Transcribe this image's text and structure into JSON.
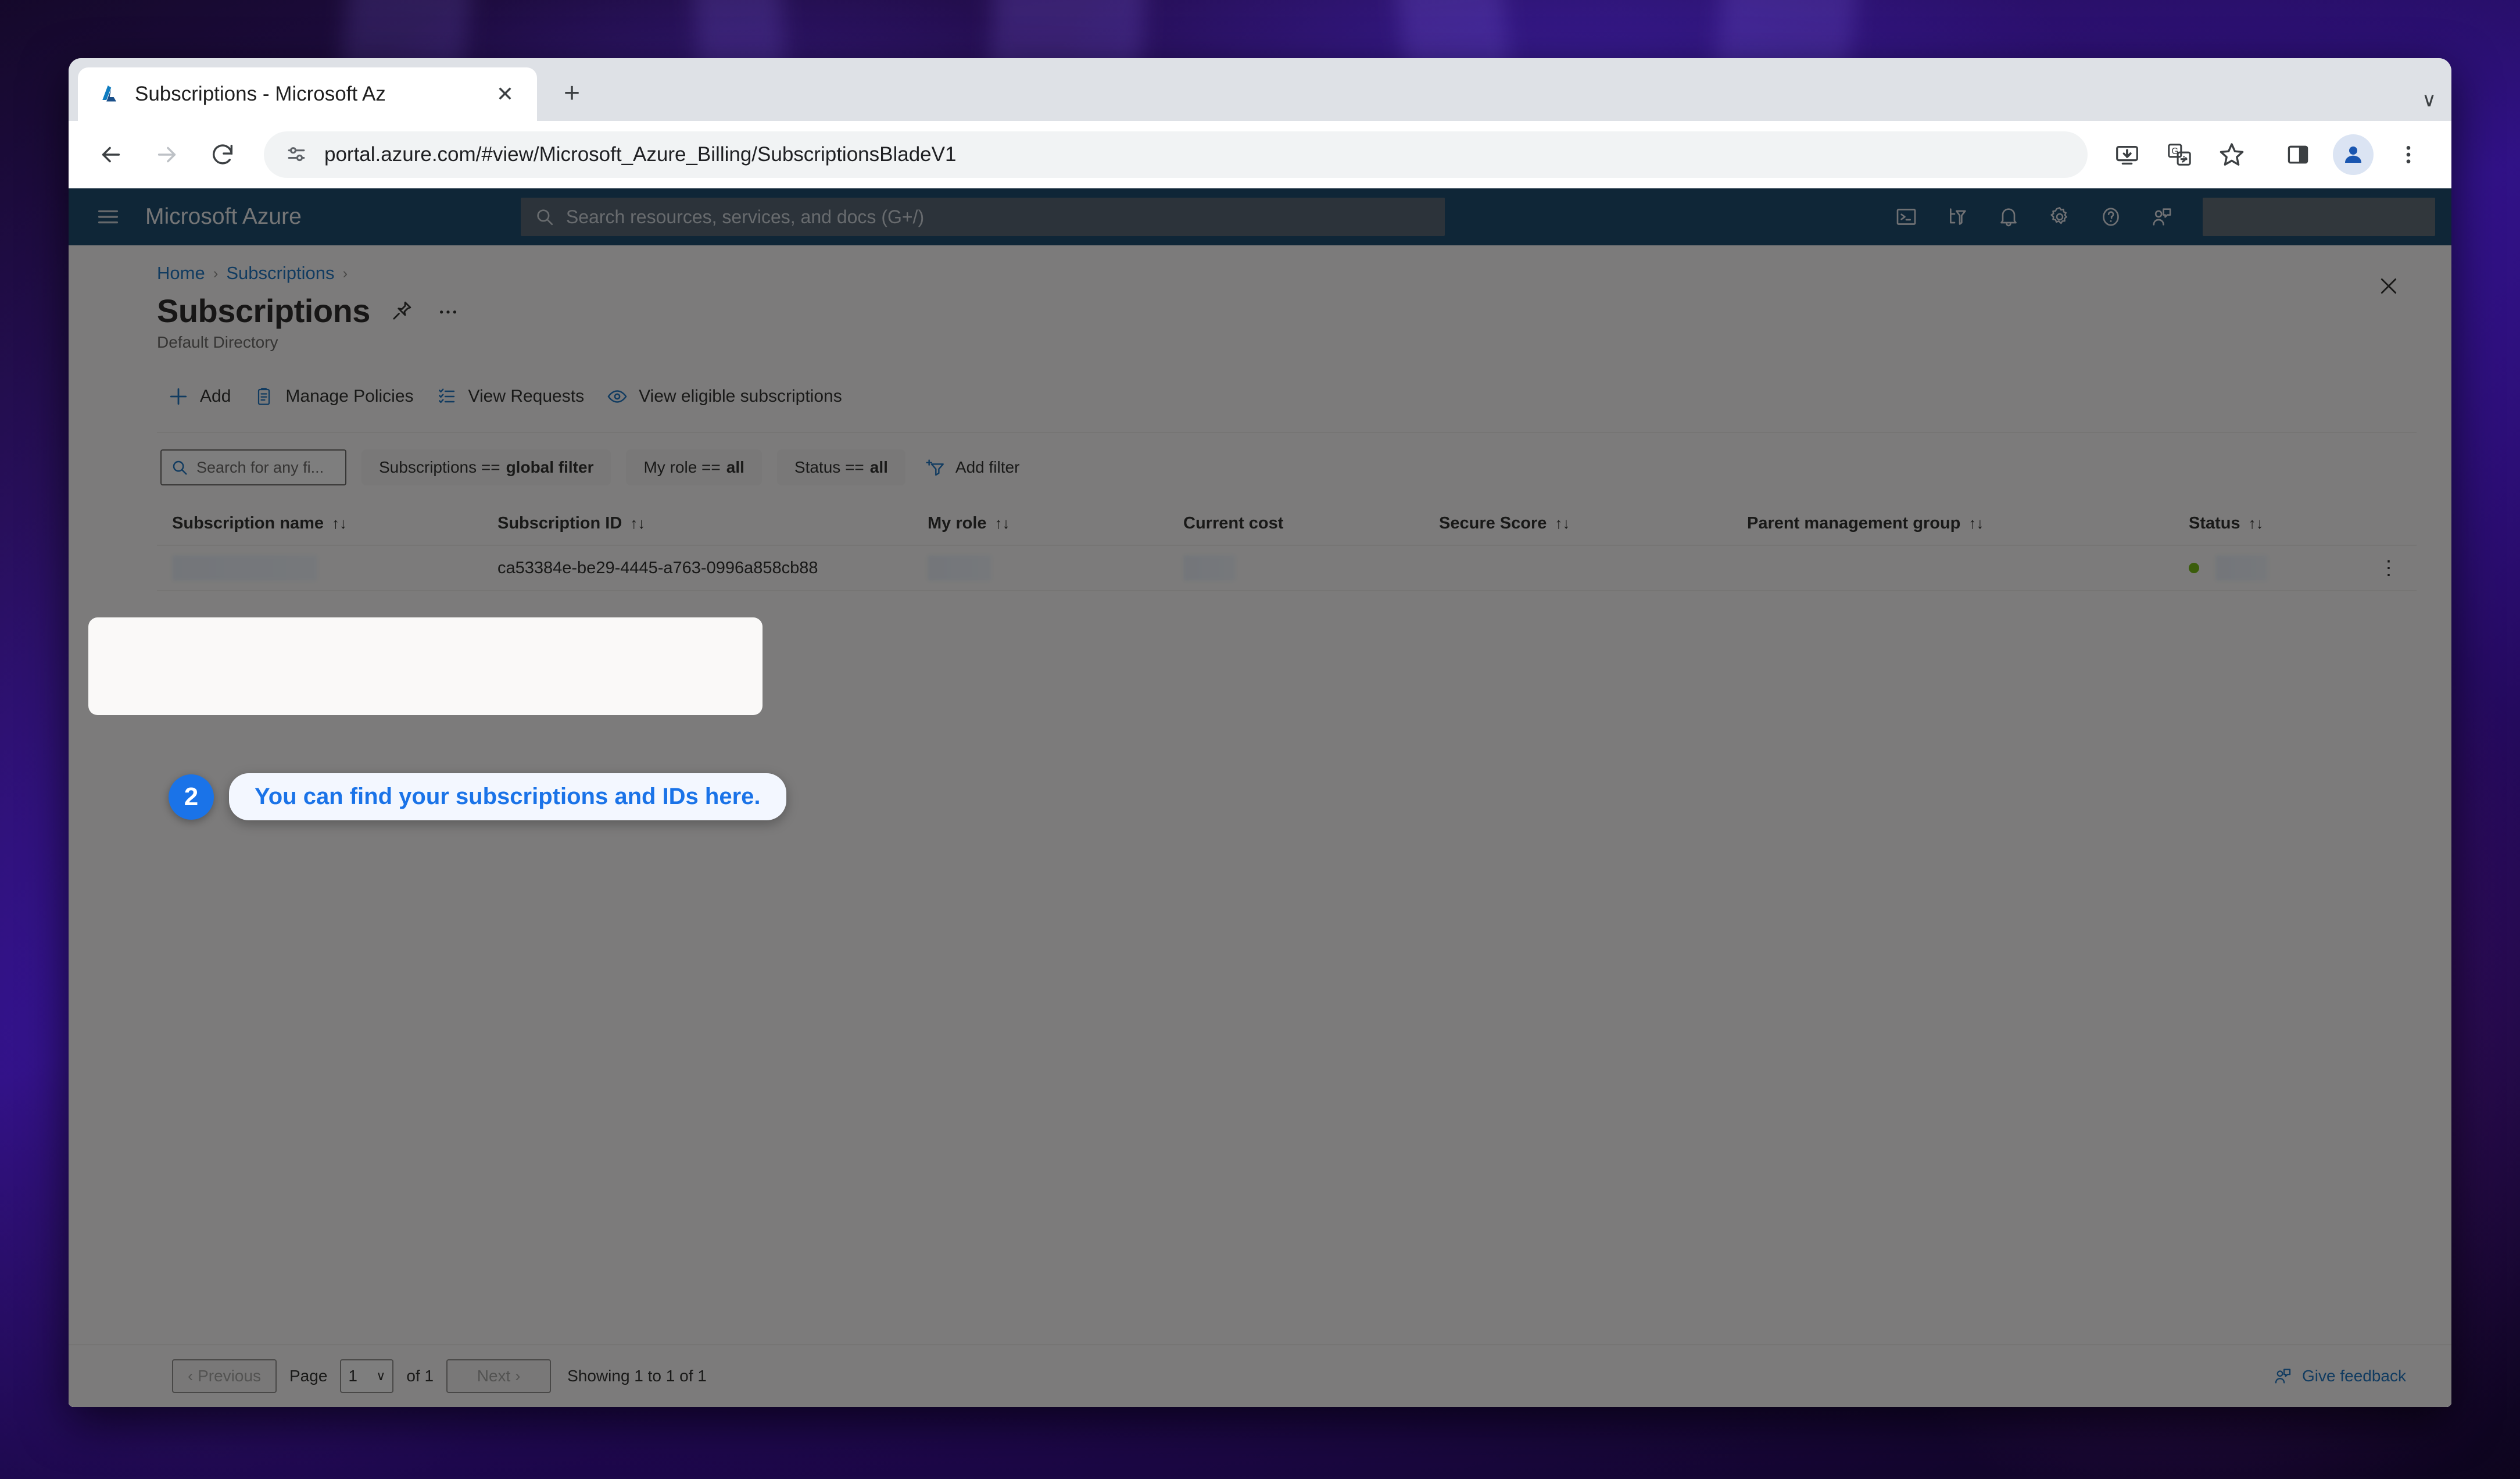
{
  "browser": {
    "tab": {
      "title": "Subscriptions - Microsoft Az",
      "favicon_name": "azure-favicon",
      "close_label": "✕"
    },
    "newtab_label": "+",
    "tabstrip_chevron": "∨",
    "nav": {
      "back": "←",
      "forward": "→",
      "reload": "⟳"
    },
    "omnibox": {
      "url": "portal.azure.com/#view/Microsoft_Azure_Billing/SubscriptionsBladeV1",
      "site_info_icon": "site-settings-icon"
    },
    "toolbar_icons": [
      "install-app-icon",
      "translate-icon",
      "bookmark-star-icon",
      "side-panel-icon",
      "profile-avatar-icon",
      "chrome-menu-icon"
    ]
  },
  "azure_nav": {
    "hamburger": "menu-icon",
    "brand": "Microsoft Azure",
    "search": {
      "placeholder": "Search resources, services, and docs (G+/)",
      "icon": "search-icon"
    },
    "icons": [
      "cloud-shell-icon",
      "directory-filter-icon",
      "notifications-bell-icon",
      "settings-gear-icon",
      "help-question-icon",
      "feedback-person-icon"
    ],
    "account_redacted": true
  },
  "blade": {
    "breadcrumb": [
      {
        "label": "Home"
      },
      {
        "label": "Subscriptions"
      }
    ],
    "breadcrumb_separator": "›",
    "title": "Subscriptions",
    "pin_icon": "pin-icon",
    "more_icon": "ellipsis-icon",
    "subtitle": "Default Directory",
    "close_label": "✕"
  },
  "command_bar": [
    {
      "label": "Add",
      "icon": "plus-icon"
    },
    {
      "label": "Manage Policies",
      "icon": "policy-clipboard-icon"
    },
    {
      "label": "View Requests",
      "icon": "list-check-icon"
    },
    {
      "label": "View eligible subscriptions",
      "icon": "eye-icon"
    }
  ],
  "filters": {
    "search_placeholder": "Search for any fi...",
    "search_icon": "search-icon",
    "pills": [
      {
        "prefix": "Subscriptions == ",
        "value": "global filter"
      },
      {
        "prefix": "My role == ",
        "value": "all"
      },
      {
        "prefix": "Status == ",
        "value": "all"
      }
    ],
    "add_filter": {
      "label": "Add filter",
      "icon": "add-filter-icon"
    }
  },
  "table": {
    "columns": [
      {
        "label": "Subscription name",
        "sortable": true,
        "sort_glyph": "↑↓"
      },
      {
        "label": "Subscription ID",
        "sortable": true,
        "sort_glyph": "↑↓"
      },
      {
        "label": "My role",
        "sortable": true,
        "sort_glyph": "↑↓"
      },
      {
        "label": "Current cost",
        "sortable": false,
        "sort_glyph": ""
      },
      {
        "label": "Secure Score",
        "sortable": true,
        "sort_glyph": "↑↓"
      },
      {
        "label": "Parent management group",
        "sortable": true,
        "sort_glyph": "↑↓"
      },
      {
        "label": "Status",
        "sortable": true,
        "sort_glyph": "↑↓"
      }
    ],
    "rows": [
      {
        "subscription_name": "",
        "subscription_id": "ca53384e-be29-4445-a763-0996a858cb88",
        "my_role": "",
        "current_cost": "",
        "secure_score": "",
        "parent_management_group": "",
        "status": "",
        "status_color": "#6bb700",
        "row_menu": "⋮"
      }
    ]
  },
  "footer": {
    "previous": "‹ Previous",
    "page_label": "Page",
    "page_value": "1",
    "page_chevron": "∨",
    "of_label": "of 1",
    "next": "Next ›",
    "showing": "Showing 1 to 1 of 1",
    "feedback": {
      "label": "Give feedback",
      "icon": "feedback-person-icon"
    }
  },
  "callout": {
    "step_number": "2",
    "text": "You can find your subscriptions and IDs here.",
    "badge_color": "#1a73e8",
    "bubble_color": "#f3f7ff"
  }
}
